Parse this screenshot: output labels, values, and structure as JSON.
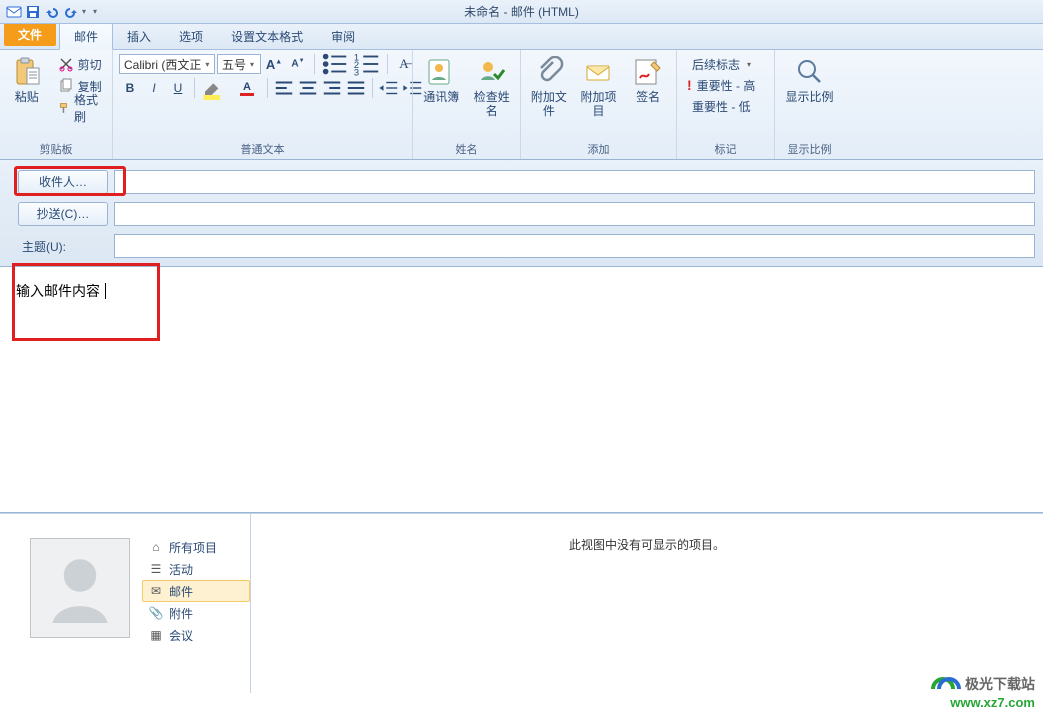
{
  "title": "未命名 - 邮件 (HTML)",
  "tabs": {
    "file": "文件",
    "mail": "邮件",
    "insert": "插入",
    "options": "选项",
    "format": "设置文本格式",
    "review": "审阅"
  },
  "ribbon": {
    "clipboard": {
      "paste": "粘贴",
      "cut": "剪切",
      "copy": "复制",
      "format_painter": "格式刷",
      "group": "剪贴板"
    },
    "font": {
      "font_name": "Calibri (西文正",
      "font_size": "五号",
      "group": "普通文本"
    },
    "names": {
      "addressbook": "通讯簿",
      "check_names": "检查姓名",
      "group": "姓名"
    },
    "add": {
      "attach_file": "附加文件",
      "attach_item": "附加项目",
      "signature": "签名",
      "group": "添加"
    },
    "tags": {
      "followup": "后续标志",
      "high": "重要性 - 高",
      "low": "重要性 - 低",
      "group": "标记"
    },
    "zoom": {
      "label": "显示比例",
      "group": "显示比例"
    }
  },
  "fields": {
    "to": "收件人…",
    "cc": "抄送(C)…",
    "subject": "主题(U):"
  },
  "body_text": "输入邮件内容",
  "nav": {
    "all": "所有项目",
    "activity": "活动",
    "mail": "邮件",
    "attachments": "附件",
    "meetings": "会议"
  },
  "preview_empty": "此视图中没有可显示的项目。",
  "watermark": {
    "name": "极光下载站",
    "url": "www.xz7.com"
  }
}
